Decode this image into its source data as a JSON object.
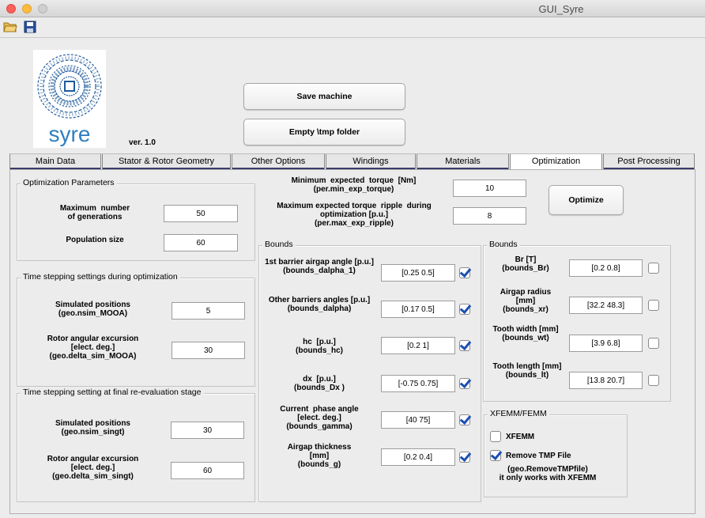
{
  "window": {
    "title": "GUI_Syre"
  },
  "toolbar": {
    "open_icon": "folder-open-icon",
    "save_icon": "floppy-disk-icon"
  },
  "header": {
    "logo_text": "syre",
    "version": "ver. 1.0",
    "save_machine": "Save machine",
    "empty_tmp": "Empty \\tmp folder"
  },
  "tabs": [
    {
      "label": "Main Data"
    },
    {
      "label": "Stator & Rotor Geometry"
    },
    {
      "label": "Other Options"
    },
    {
      "label": "Windings"
    },
    {
      "label": "Materials"
    },
    {
      "label": "Optimization"
    },
    {
      "label": "Post Processing"
    }
  ],
  "optim_params": {
    "title": "Optimization Parameters",
    "generations_label": "Maximum  number\nof generations",
    "generations_value": "50",
    "population_label": "Population size",
    "population_value": "60"
  },
  "time_step": {
    "title": "Time stepping settings during optimization",
    "positions_label": "Simulated positions\n(geo.nsim_MOOA)",
    "positions_value": "5",
    "excursion_label": "Rotor angular excursion\n[elect. deg.]\n(geo.delta_sim_MOOA)",
    "excursion_value": "30"
  },
  "final_step": {
    "title": "Time stepping setting at final re-evaluation stage",
    "positions_label": "Simulated positions\n(geo.nsim_singt)",
    "positions_value": "30",
    "excursion_label": "Rotor angular excursion\n[elect. deg.]\n(geo.delta_sim_singt)",
    "excursion_value": "60"
  },
  "objectives": {
    "min_torque_label": "Minimum  expected  torque  [Nm]\n(per.min_exp_torque)",
    "min_torque_value": "10",
    "max_ripple_label": "Maximum expected torque  ripple  during\noptimization [p.u.]\n(per.max_exp_ripple)",
    "max_ripple_value": "8",
    "optimize_button": "Optimize"
  },
  "bounds_left": {
    "title": "Bounds",
    "items": [
      {
        "label": "1st barrier airgap angle [p.u.]\n(bounds_dalpha_1)",
        "value": "[0.25 0.5]",
        "checked": true
      },
      {
        "label": "Other barriers angles [p.u.]\n(bounds_dalpha)",
        "value": "[0.17 0.5]",
        "checked": true
      },
      {
        "label": "hc  [p.u.]\n(bounds_hc)",
        "value": "[0.2 1]",
        "checked": true
      },
      {
        "label": "dx  [p.u.]\n(bounds_Dx )",
        "value": "[-0.75 0.75]",
        "checked": true
      },
      {
        "label": "Current  phase angle\n[elect. deg.]\n(bounds_gamma)",
        "value": "[40 75]",
        "checked": true
      },
      {
        "label": "Airgap thickness\n[mm]\n(bounds_g)",
        "value": "[0.2 0.4]",
        "checked": true
      }
    ]
  },
  "bounds_right": {
    "title": "Bounds",
    "items": [
      {
        "label": "Br [T]\n(bounds_Br)",
        "value": "[0.2 0.8]",
        "checked": false
      },
      {
        "label": "Airgap radius\n[mm]\n(bounds_xr)",
        "value": "[32.2 48.3]",
        "checked": false
      },
      {
        "label": "Tooth width [mm]\n(bounds_wt)",
        "value": "[3.9 6.8]",
        "checked": false
      },
      {
        "label": "Tooth length [mm]\n(bounds_lt)",
        "value": "[13.8 20.7]",
        "checked": false
      }
    ]
  },
  "xfemm": {
    "title": "XFEMM/FEMM",
    "xfemm_label": "XFEMM",
    "xfemm_checked": false,
    "remove_label": "Remove TMP File",
    "remove_checked": true,
    "note": "(geo.RemoveTMPfile)\nit only works with XFEMM"
  }
}
